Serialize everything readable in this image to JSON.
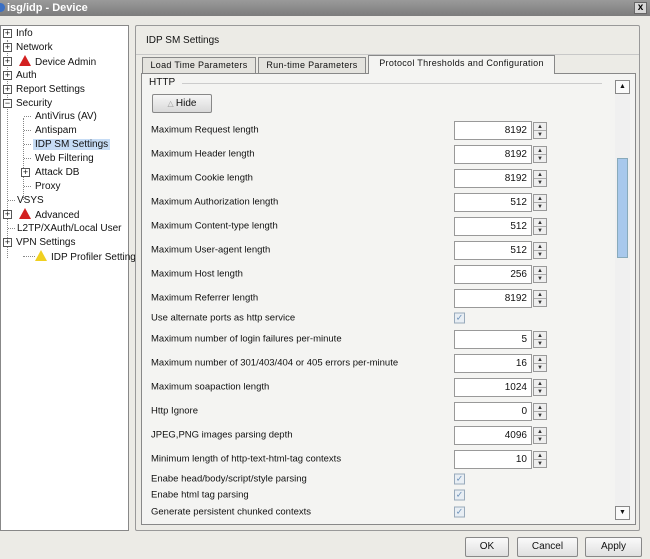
{
  "window": {
    "title": "isg/idp - Device",
    "close": "x"
  },
  "tree": {
    "info": "Info",
    "network": "Network",
    "device_admin": "Device Admin",
    "auth": "Auth",
    "report": "Report Settings",
    "security": "Security",
    "antivirus": "AntiVirus (AV)",
    "antispam": "Antispam",
    "idp_sm": "IDP SM Settings",
    "web_filtering": "Web Filtering",
    "attack_db": "Attack DB",
    "proxy": "Proxy",
    "vsys": "VSYS",
    "advanced": "Advanced",
    "l2tp": "L2TP/XAuth/Local User",
    "vpn": "VPN Settings",
    "idp_profiler": "IDP Profiler Settings"
  },
  "main": {
    "title": "IDP SM Settings",
    "tabs": [
      "Load Time Parameters",
      "Run-time Parameters",
      "Protocol Thresholds and Configuration"
    ],
    "section": "HTTP",
    "hide_label": "Hide",
    "rows": [
      {
        "label": "Maximum Request length",
        "value": "8192"
      },
      {
        "label": "Maximum Header length",
        "value": "8192"
      },
      {
        "label": "Maximum Cookie length",
        "value": "8192"
      },
      {
        "label": "Maximum Authorization length",
        "value": "512"
      },
      {
        "label": "Maximum Content-type length",
        "value": "512"
      },
      {
        "label": "Maximum User-agent length",
        "value": "512"
      },
      {
        "label": "Maximum Host length",
        "value": "256"
      },
      {
        "label": "Maximum Referrer length",
        "value": "8192"
      },
      {
        "label": "Use alternate ports as http service",
        "checked": true
      },
      {
        "label": "Maximum number of login failures per-minute",
        "value": "5"
      },
      {
        "label": "Maximum number of 301/403/404 or 405 errors per-minute",
        "value": "16"
      },
      {
        "label": "Maximum soapaction length",
        "value": "1024"
      },
      {
        "label": "Http Ignore",
        "value": "0"
      },
      {
        "label": "JPEG,PNG images parsing depth",
        "value": "4096"
      },
      {
        "label": "Minimum length of http-text-html-tag contexts",
        "value": "10"
      },
      {
        "label": "Enabe head/body/script/style parsing",
        "checked": true
      },
      {
        "label": "Enabe html tag parsing",
        "checked": true
      },
      {
        "label": "Generate persistent chunked contexts",
        "checked": true
      }
    ]
  },
  "buttons": {
    "ok": "OK",
    "cancel": "Cancel",
    "apply": "Apply"
  }
}
